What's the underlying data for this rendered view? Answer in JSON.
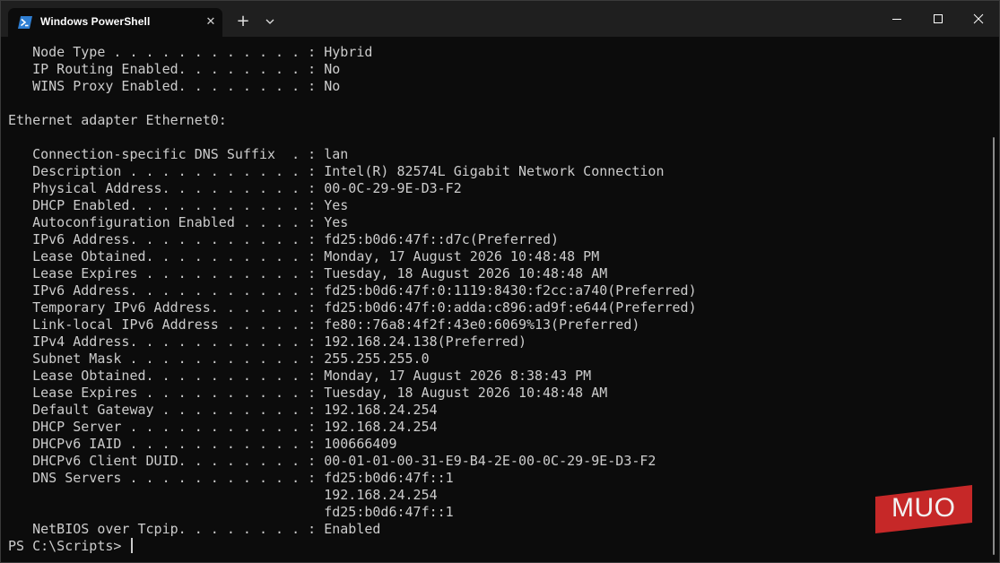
{
  "tab": {
    "title": "Windows PowerShell",
    "icon": "powershell-icon",
    "close_icon": "close-icon"
  },
  "toolbar": {
    "new_tab_label": "+",
    "dropdown_icon": "chevron-down-icon"
  },
  "window_controls": {
    "minimize_icon": "minimize-icon",
    "maximize_icon": "maximize-icon",
    "close_icon": "close-icon"
  },
  "terminal": {
    "lines": [
      "   Node Type . . . . . . . . . . . . : Hybrid",
      "   IP Routing Enabled. . . . . . . . : No",
      "   WINS Proxy Enabled. . . . . . . . : No",
      "",
      "Ethernet adapter Ethernet0:",
      "",
      "   Connection-specific DNS Suffix  . : lan",
      "   Description . . . . . . . . . . . : Intel(R) 82574L Gigabit Network Connection",
      "   Physical Address. . . . . . . . . : 00-0C-29-9E-D3-F2",
      "   DHCP Enabled. . . . . . . . . . . : Yes",
      "   Autoconfiguration Enabled . . . . : Yes",
      "   IPv6 Address. . . . . . . . . . . : fd25:b0d6:47f::d7c(Preferred)",
      "   Lease Obtained. . . . . . . . . . : Monday, 17 August 2026 10:48:48 PM",
      "   Lease Expires . . . . . . . . . . : Tuesday, 18 August 2026 10:48:48 AM",
      "   IPv6 Address. . . . . . . . . . . : fd25:b0d6:47f:0:1119:8430:f2cc:a740(Preferred)",
      "   Temporary IPv6 Address. . . . . . : fd25:b0d6:47f:0:adda:c896:ad9f:e644(Preferred)",
      "   Link-local IPv6 Address . . . . . : fe80::76a8:4f2f:43e0:6069%13(Preferred)",
      "   IPv4 Address. . . . . . . . . . . : 192.168.24.138(Preferred)",
      "   Subnet Mask . . . . . . . . . . . : 255.255.255.0",
      "   Lease Obtained. . . . . . . . . . : Monday, 17 August 2026 8:38:43 PM",
      "   Lease Expires . . . . . . . . . . : Tuesday, 18 August 2026 10:48:48 AM",
      "   Default Gateway . . . . . . . . . : 192.168.24.254",
      "   DHCP Server . . . . . . . . . . . : 192.168.24.254",
      "   DHCPv6 IAID . . . . . . . . . . . : 100666409",
      "   DHCPv6 Client DUID. . . . . . . . : 00-01-01-00-31-E9-B4-2E-00-0C-29-9E-D3-F2",
      "   DNS Servers . . . . . . . . . . . : fd25:b0d6:47f::1",
      "                                       192.168.24.254",
      "                                       fd25:b0d6:47f::1",
      "   NetBIOS over Tcpip. . . . . . . . : Enabled"
    ],
    "prompt": "PS C:\\Scripts> "
  },
  "watermark": {
    "text": "MUO",
    "color": "#c62828"
  },
  "colors": {
    "background": "#0c0c0c",
    "titlebar": "#1f1f1f",
    "text": "#cccccc"
  }
}
